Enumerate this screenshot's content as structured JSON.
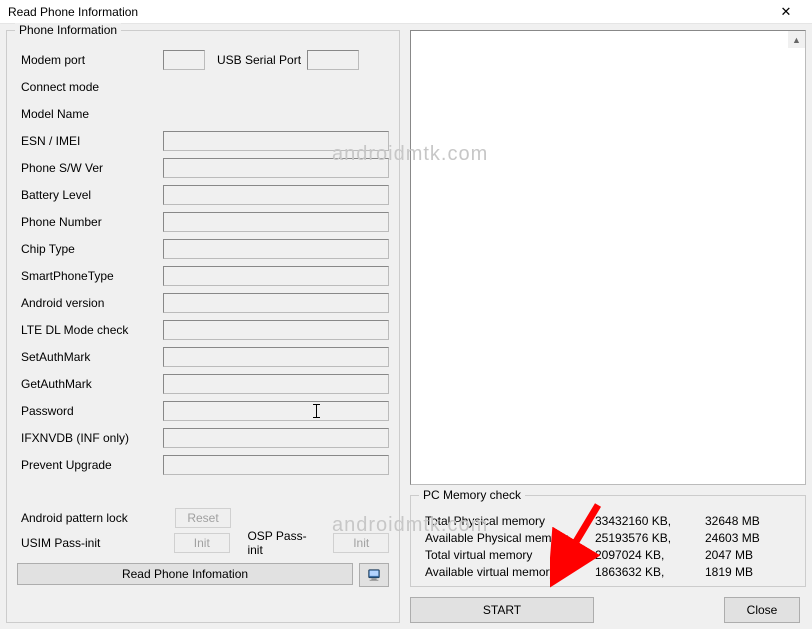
{
  "title": "Read Phone Information",
  "watermark": "androidmtk.com",
  "phone_group_legend": "Phone Information",
  "fields": {
    "modem_port": {
      "label": "Modem port",
      "value": ""
    },
    "usb_serial": {
      "label": "USB Serial Port",
      "value": ""
    },
    "connect_mode": {
      "label": "Connect mode",
      "value": ""
    },
    "model_name": {
      "label": "Model Name",
      "value": ""
    },
    "esn_imei": {
      "label": "ESN / IMEI",
      "value": ""
    },
    "phone_sw": {
      "label": "Phone S/W Ver",
      "value": ""
    },
    "battery": {
      "label": "Battery Level",
      "value": ""
    },
    "phone_number": {
      "label": "Phone Number",
      "value": ""
    },
    "chip_type": {
      "label": "Chip Type",
      "value": ""
    },
    "smartphone_type": {
      "label": "SmartPhoneType",
      "value": ""
    },
    "android_version": {
      "label": "Android version",
      "value": ""
    },
    "lte_dl": {
      "label": "LTE DL Mode check",
      "value": ""
    },
    "set_auth": {
      "label": "SetAuthMark",
      "value": ""
    },
    "get_auth": {
      "label": "GetAuthMark",
      "value": ""
    },
    "password": {
      "label": "Password",
      "value": ""
    },
    "ifxnvdb": {
      "label": "IFXNVDB (INF only)",
      "value": ""
    },
    "prevent_upgrade": {
      "label": "Prevent Upgrade",
      "value": ""
    }
  },
  "tools": {
    "pattern_lock_label": "Android pattern lock",
    "reset_btn": "Reset",
    "usim_label": "USIM Pass-init",
    "usim_init_btn": "Init",
    "osp_label": "OSP Pass-init",
    "osp_init_btn": "Init",
    "read_btn": "Read Phone Infomation"
  },
  "mem": {
    "legend": "PC Memory check",
    "total_phys_label": "Total Physical memory",
    "total_phys_kb": "33432160 KB,",
    "total_phys_mb": "32648 MB",
    "avail_phys_label": "Available Physical memory",
    "avail_phys_kb": "25193576 KB,",
    "avail_phys_mb": "24603 MB",
    "total_virt_label": "Total virtual memory",
    "total_virt_kb": "2097024 KB,",
    "total_virt_mb": "2047 MB",
    "avail_virt_label": "Available virtual memory",
    "avail_virt_kb": "1863632 KB,",
    "avail_virt_mb": "1819 MB"
  },
  "buttons": {
    "start": "START",
    "close": "Close"
  }
}
